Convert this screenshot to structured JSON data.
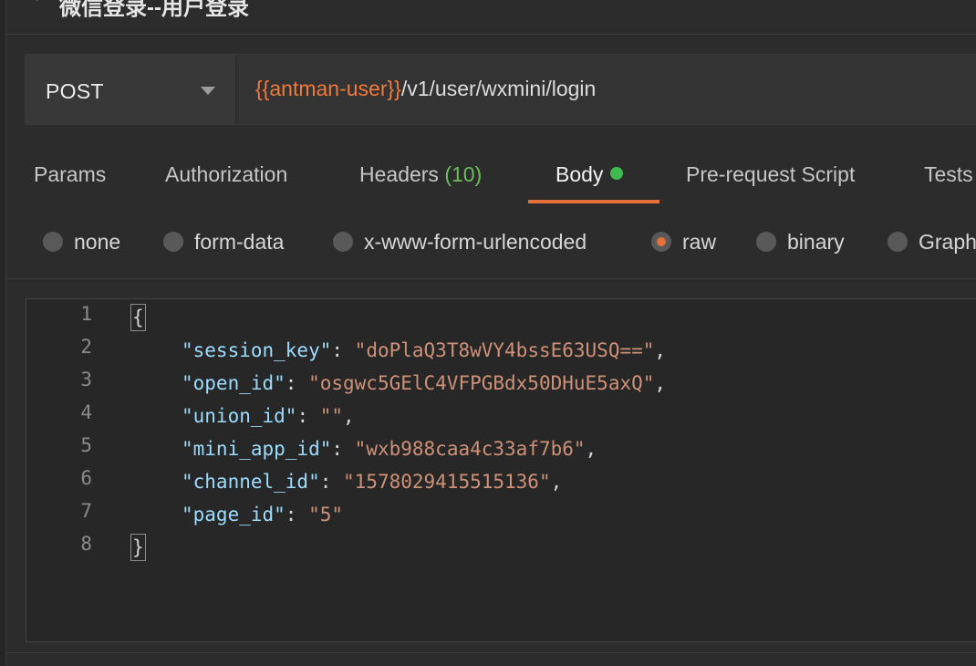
{
  "request": {
    "title": "微信登录--用户登录",
    "method": "POST",
    "url_variable": "{{antman-user}}",
    "url_path": "/v1/user/wxmini/login"
  },
  "tabs": [
    {
      "label": "Params"
    },
    {
      "label": "Authorization"
    },
    {
      "label": "Headers",
      "count": "(10)"
    },
    {
      "label": "Body",
      "active": true
    },
    {
      "label": "Pre-request Script"
    },
    {
      "label": "Tests"
    }
  ],
  "body_types": [
    {
      "label": "none",
      "checked": false
    },
    {
      "label": "form-data",
      "checked": false
    },
    {
      "label": "x-www-form-urlencoded",
      "checked": false
    },
    {
      "label": "raw",
      "checked": true
    },
    {
      "label": "binary",
      "checked": false
    },
    {
      "label": "GraphQL",
      "checked": false
    }
  ],
  "editor": {
    "line_numbers": [
      "1",
      "2",
      "3",
      "4",
      "5",
      "6",
      "7",
      "8"
    ],
    "open_brace": "{",
    "close_brace": "}",
    "fields": [
      {
        "key": "\"session_key\"",
        "value": "\"doPlaQ3T8wVY4bssE63USQ==\"",
        "sep": ",",
        "colon": ": "
      },
      {
        "key": "\"open_id\"",
        "value": "\"osgwc5GElC4VFPGBdx50DHuE5axQ\"",
        "sep": ",",
        "colon": ": "
      },
      {
        "key": "\"union_id\"",
        "value": "\"\"",
        "sep": ",",
        "colon": ": "
      },
      {
        "key": "\"mini_app_id\"",
        "value": "\"wxb988caa4c33af7b6\"",
        "sep": ",",
        "colon": ": "
      },
      {
        "key": "\"channel_id\"",
        "value": "\"1578029415515136\"",
        "sep": ",",
        "colon": ": "
      },
      {
        "key": "\"page_id\"",
        "value": "\"5\"",
        "sep": "",
        "colon": ": "
      }
    ]
  },
  "colors": {
    "accent": "#e4703b",
    "url_variable": "#f07a3c",
    "headers_count": "#6bbd5b",
    "body_dot": "#3fb950",
    "json_key": "#9cdcfe",
    "json_string": "#ce9178"
  }
}
